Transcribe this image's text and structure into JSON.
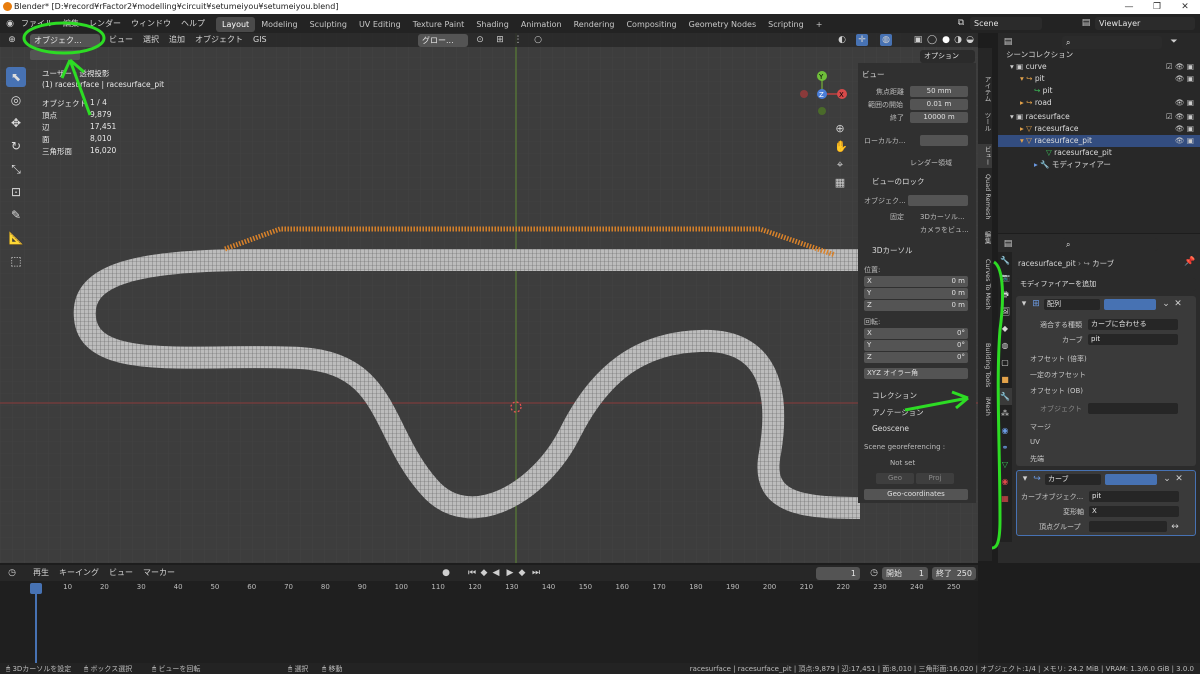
{
  "titlebar": {
    "title": "Blender* [D:¥record¥rFactor2¥modelling¥circuit¥setumeiyou¥setumeiyou.blend]",
    "minimize": "—",
    "maximize": "❐",
    "close": "✕"
  },
  "menu": [
    "ファイル",
    "編集",
    "レンダー",
    "ウィンドウ",
    "ヘルプ"
  ],
  "workspaces": [
    "Layout",
    "Modeling",
    "Sculpting",
    "UV Editing",
    "Texture Paint",
    "Shading",
    "Animation",
    "Rendering",
    "Compositing",
    "Geometry Nodes",
    "Scripting",
    "+"
  ],
  "active_workspace": "Layout",
  "scene": {
    "label": "Scene",
    "viewlayer": "ViewLayer"
  },
  "viewport_header": {
    "mode": "オブジェク...",
    "menus": [
      "ビュー",
      "選択",
      "追加",
      "オブジェクト",
      "GIS"
    ],
    "orientation": "グロー...",
    "options": "オプション"
  },
  "viewport_info": {
    "view_name": "ユーザー・透視投影",
    "object_line": "(1) racesurface | racesurface_pit",
    "stats": [
      {
        "label": "オブジェクト",
        "value": "1 / 4"
      },
      {
        "label": "頂点",
        "value": "9,879"
      },
      {
        "label": "辺",
        "value": "17,451"
      },
      {
        "label": "面",
        "value": "8,010"
      },
      {
        "label": "三角形面",
        "value": "16,020"
      }
    ]
  },
  "gizmo": {
    "x": "X",
    "y": "Y",
    "z": "Z"
  },
  "npanel": {
    "view_header": "ビュー",
    "focal_label": "焦点距離",
    "focal_value": "50 mm",
    "clip_start_label": "範囲の開始",
    "clip_start_value": "0.01 m",
    "clip_end_label": "終了",
    "clip_end_value": "10000 m",
    "local_camera_label": "ローカルカ...",
    "render_region": "レンダー領域",
    "view_lock_header": "ビューのロック",
    "lock_object_label": "オブジェク...",
    "lock_fixed_label": "固定",
    "lock_3dcursor": "3Dカーソル...",
    "lock_camera": "カメラをビュ...",
    "cursor_header": "3Dカーソル",
    "location_label": "位置:",
    "loc": [
      {
        "axis": "X",
        "value": "0 m"
      },
      {
        "axis": "Y",
        "value": "0 m"
      },
      {
        "axis": "Z",
        "value": "0 m"
      }
    ],
    "rotation_label": "回転:",
    "rot": [
      {
        "axis": "X",
        "value": "0°"
      },
      {
        "axis": "Y",
        "value": "0°"
      },
      {
        "axis": "Z",
        "value": "0°"
      }
    ],
    "rot_mode": "XYZ オイラー角",
    "collection_header": "コレクション",
    "annotation_header": "アノテーション",
    "geoscene_header": "Geoscene",
    "georef_label": "Scene georeferencing :",
    "not_set": "Not set",
    "geo_btn": "Geo",
    "proj_btn": "Proj",
    "geo_coords": "Geo-coordinates"
  },
  "ntabs": [
    "アイテム",
    "ツール",
    "ビュー",
    "Quad Remesh",
    "編集",
    "Curves To Mesh",
    "Building Tools",
    "iMesh"
  ],
  "outliner": {
    "title": "シーンコレクション",
    "rows": [
      "curve",
      "pit",
      "pit",
      "road",
      "racesurface",
      "racesurface",
      "racesurface_pit",
      "racesurface_pit",
      "モディファイアー"
    ]
  },
  "properties": {
    "breadcrumb_obj": "racesurface_pit",
    "breadcrumb_mod": "カーブ",
    "add_modifier": "モディファイアーを追加",
    "array": {
      "name": "配列",
      "fit_label": "適合する種類",
      "fit_value": "カーブに合わせる",
      "curve_label": "カーブ",
      "curve_value": "pit",
      "relative_offset": "オフセット (倍率)",
      "constant_offset": "一定のオフセット",
      "object_offset": "オフセット (OB)",
      "object_label": "オブジェクト",
      "merge": "マージ",
      "uv": "UV",
      "caps": "先端"
    },
    "curve_mod": {
      "name": "カーブ",
      "curve_obj_label": "カーブオブジェク...",
      "curve_obj_value": "pit",
      "deform_label": "変形軸",
      "deform_value": "X",
      "vgroup_label": "頂点グループ"
    }
  },
  "timeline": {
    "menus": [
      "再生",
      "キーイング",
      "ビュー",
      "マーカー"
    ],
    "current_frame": "1",
    "start_label": "開始",
    "start": "1",
    "end_label": "終了",
    "end": "250",
    "ticks": [
      "1",
      "10",
      "20",
      "30",
      "40",
      "50",
      "60",
      "70",
      "80",
      "90",
      "100",
      "110",
      "120",
      "130",
      "140",
      "150",
      "160",
      "170",
      "180",
      "190",
      "200",
      "210",
      "220",
      "230",
      "240",
      "250"
    ]
  },
  "statusbar": {
    "left": [
      "3Dカーソルを設定",
      "ボックス選択",
      "ビューを回転",
      "選択",
      "移動"
    ],
    "right": "racesurface | racesurface_pit | 頂点:9,879 | 辺:17,451 | 面:8,010 | 三角形面:16,020 | オブジェクト:1/4 | メモリ: 24.2 MiB | VRAM: 1.3/6.0 GiB | 3.0.0"
  },
  "colors": {
    "accent": "#4772b3",
    "annotation": "#2ddc24",
    "selected": "#e38a2a"
  }
}
